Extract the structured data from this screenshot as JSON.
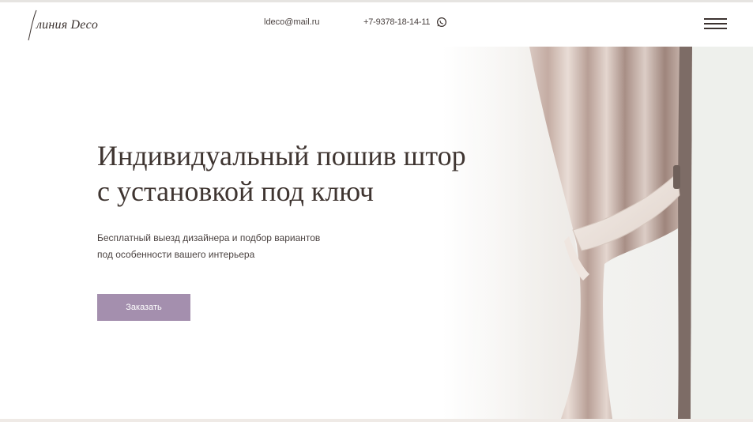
{
  "header": {
    "logo_text": "линия Deco",
    "email": "ldeco@mail.ru",
    "phone": "+7-9378-18-14-11",
    "whatsapp_icon": "whatsapp-icon",
    "menu_icon": "hamburger-menu-icon"
  },
  "hero": {
    "title_line1": "Индивидуальный пошив штор",
    "title_line2": "с установкой под ключ",
    "subtitle_line1": "Бесплатный выезд дизайнера и подбор вариантов",
    "subtitle_line2": "под особенности вашего интерьера",
    "cta_label": "Заказать"
  },
  "colors": {
    "accent": "#a48fae",
    "text_dark": "#3f3531",
    "background": "#ffffff"
  }
}
